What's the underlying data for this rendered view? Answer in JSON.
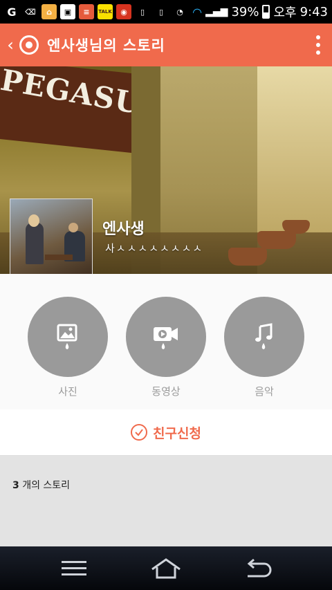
{
  "status_bar": {
    "battery_percent": "39%",
    "ampm": "오후",
    "time": "9:43",
    "notification_icons": [
      "notification-icon-1",
      "back-arrow-icon",
      "home-icon",
      "image-icon",
      "stack-icon",
      "kakaotalk-icon",
      "game-icon",
      "phone-icon",
      "vibrate-icon",
      "alarm-icon",
      "wifi-icon",
      "signal-icon",
      "battery-icon"
    ]
  },
  "header": {
    "title": "엔사생님의 스토리",
    "accent_color": "#f06a4c"
  },
  "profile": {
    "name": "엔사생",
    "status": "사ㅅㅅㅅㅅㅅㅅㅅㅅ",
    "cover_sign_text": "PEGASUS"
  },
  "media": {
    "items": [
      {
        "label": "사진",
        "icon": "photo-icon"
      },
      {
        "label": "동영상",
        "icon": "video-icon"
      },
      {
        "label": "음악",
        "icon": "music-icon"
      }
    ]
  },
  "friend_request": {
    "label": "친구신청"
  },
  "stories": {
    "count": "3",
    "suffix": " 개의 스토리"
  },
  "navbar": {
    "buttons": [
      "menu-icon",
      "home-icon",
      "back-icon"
    ]
  }
}
